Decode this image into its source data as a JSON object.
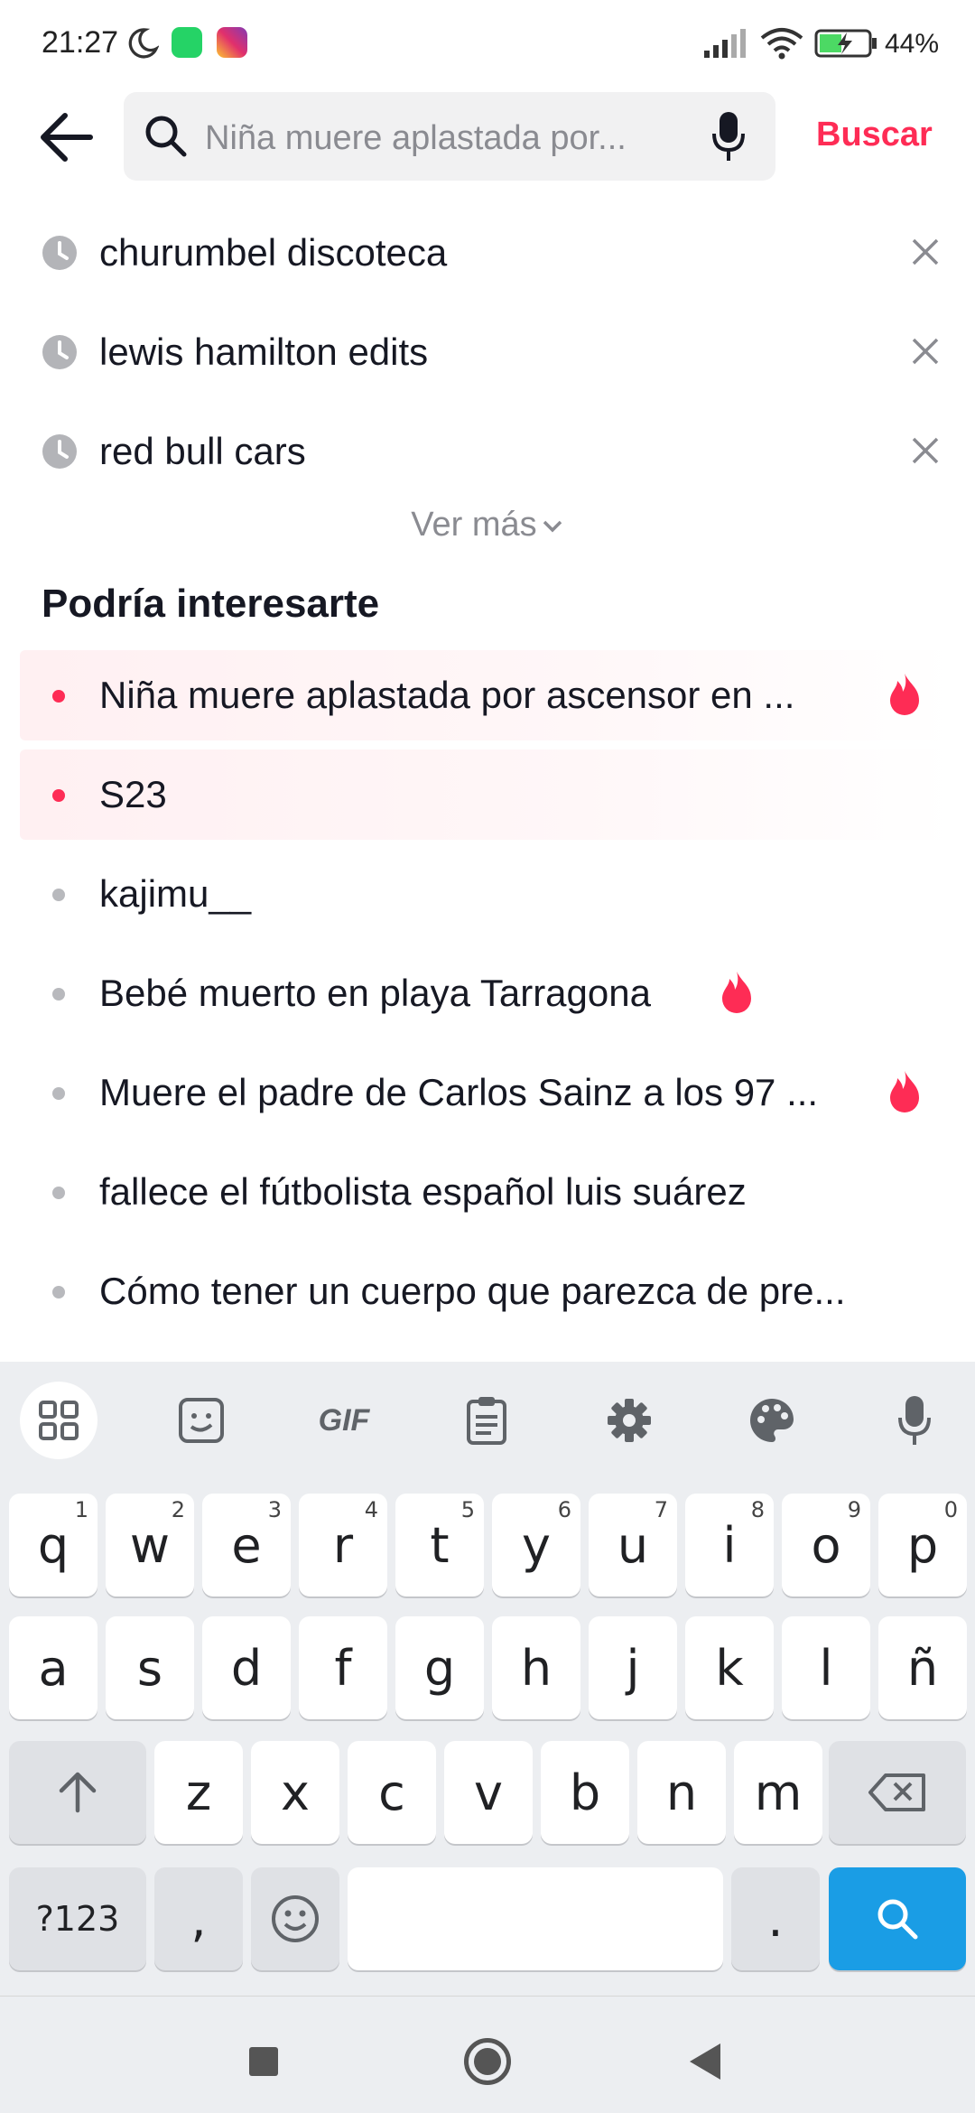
{
  "status_bar": {
    "time": "21:27",
    "battery": "44%"
  },
  "search": {
    "query": "Niña muere aplastada por...",
    "submit_label": "Buscar"
  },
  "history": [
    {
      "label": "churumbel discoteca"
    },
    {
      "label": "lewis hamilton edits"
    },
    {
      "label": "red bull cars"
    }
  ],
  "see_more_label": "Ver más",
  "suggestions_title": "Podría interesarte",
  "suggestions": [
    {
      "label": "Niña muere aplastada por ascensor en ...",
      "highlighted": true,
      "trending": true
    },
    {
      "label": "S23",
      "highlighted": true,
      "trending": false
    },
    {
      "label": "kajimu__",
      "highlighted": false,
      "trending": false
    },
    {
      "label": "Bebé muerto en playa Tarragona",
      "highlighted": false,
      "trending": true
    },
    {
      "label": "Muere el padre de Carlos Sainz a los 97 ...",
      "highlighted": false,
      "trending": true
    },
    {
      "label": "fallece el fútbolista español luis suárez",
      "highlighted": false,
      "trending": false
    },
    {
      "label": "Cómo tener un cuerpo que parezca de pre...",
      "highlighted": false,
      "trending": false
    }
  ],
  "keyboard": {
    "toolbar": {
      "gif_label": "GIF"
    },
    "row1": [
      "q",
      "w",
      "e",
      "r",
      "t",
      "y",
      "u",
      "i",
      "o",
      "p"
    ],
    "row1_nums": [
      "1",
      "2",
      "3",
      "4",
      "5",
      "6",
      "7",
      "8",
      "9",
      "0"
    ],
    "row2": [
      "a",
      "s",
      "d",
      "f",
      "g",
      "h",
      "j",
      "k",
      "l",
      "ñ"
    ],
    "row3": [
      "z",
      "x",
      "c",
      "v",
      "b",
      "n",
      "m"
    ],
    "symbols_label": "?123",
    "comma": ",",
    "period": "."
  },
  "colors": {
    "accent": "#fe2c55",
    "search_key": "#1a9de5"
  }
}
